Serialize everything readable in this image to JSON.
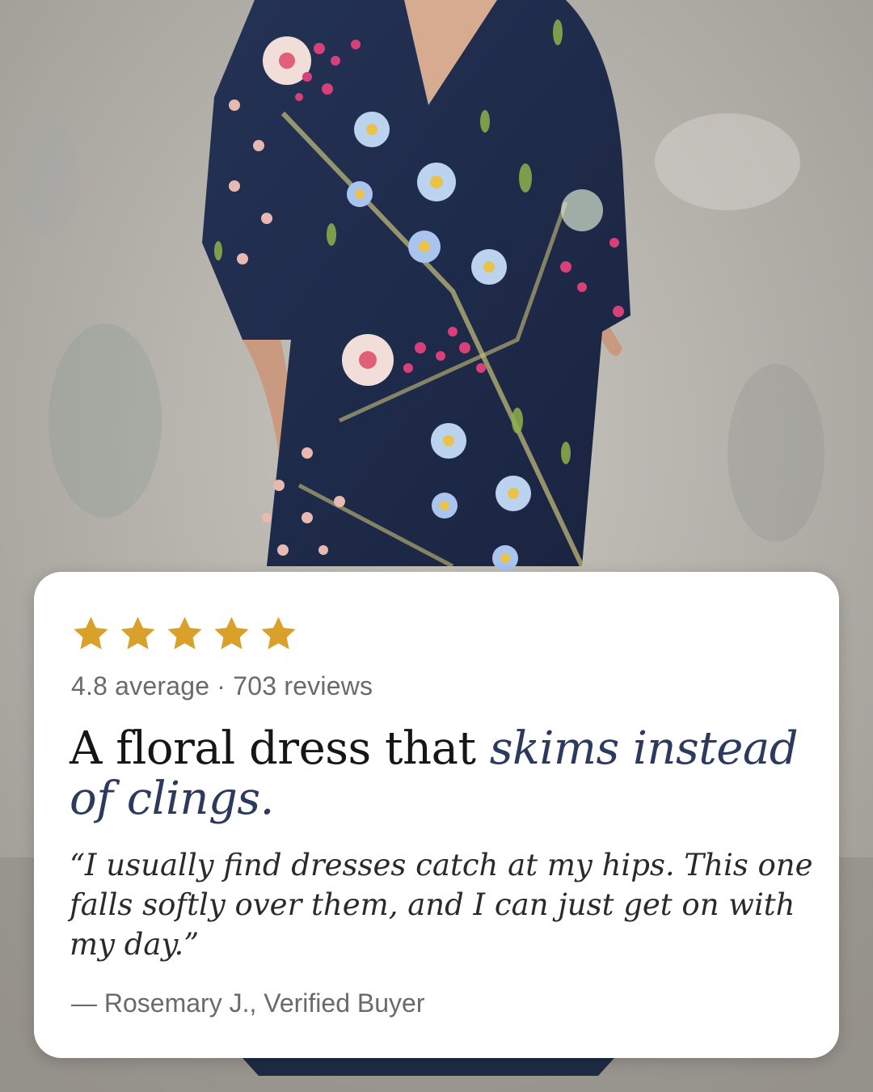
{
  "review_card": {
    "star_count": 5,
    "star_color": "#D9A12A",
    "rating_summary": "4.8 average · 703 reviews",
    "headline_plain": "A floral dress that ",
    "headline_accent": "skims instead of clings.",
    "accent_color": "#2B3A5E",
    "quote": "“I usually find dresses catch at my hips. This one falls softly over them, and I can just get on with my day.”",
    "attribution": "— Rosemary J., Verified Buyer"
  },
  "photo": {
    "wall_color": "#B9B6B0",
    "dress_color": "#1F2B45"
  }
}
